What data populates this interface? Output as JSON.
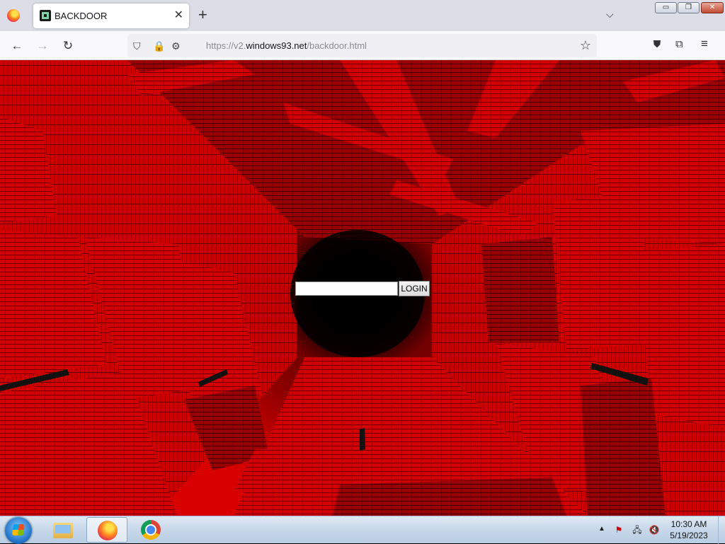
{
  "browser": {
    "tab": {
      "title": "BACKDOOR",
      "close_glyph": "✕"
    },
    "new_tab_glyph": "+",
    "tab_list_glyph": "⌵",
    "window_controls": {
      "minimize": "▭",
      "maximize": "❐",
      "close": "✕"
    },
    "nav": {
      "back": "←",
      "forward": "→",
      "reload": "↻"
    },
    "url": {
      "prefix": "https://v2.",
      "domain": "windows93.net",
      "path": "/backdoor.html"
    },
    "icons": {
      "shield": "⛉",
      "lock": "🔒",
      "permissions": "⚙",
      "bookmark": "☆",
      "pocket": "⛊",
      "extensions": "⧉",
      "menu": "≡"
    }
  },
  "page": {
    "login_input": {
      "value": "",
      "placeholder": ""
    },
    "login_button": "LOGIN"
  },
  "taskbar": {
    "apps": [
      "explorer-icon",
      "firefox-icon",
      "chrome-icon"
    ],
    "tray_arrow": "▲",
    "tray_icons": {
      "flag": "⚑",
      "network": "🖧",
      "volume": "🔇"
    },
    "clock": {
      "time": "10:30 AM",
      "date": "5/19/2023"
    }
  }
}
